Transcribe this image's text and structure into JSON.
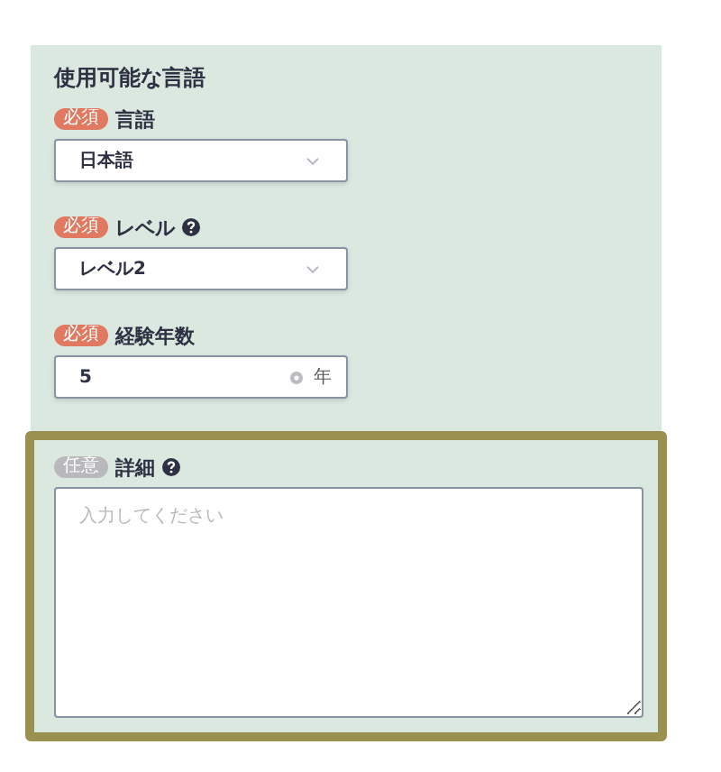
{
  "section": {
    "title": "使用可能な言語"
  },
  "fields": [
    {
      "kind": "select",
      "badge": "必須",
      "required": true,
      "label": "言語",
      "help": false,
      "value": "日本語",
      "highlighted": false
    },
    {
      "kind": "select",
      "badge": "必須",
      "required": true,
      "label": "レベル",
      "help": true,
      "value": "レベル2",
      "highlighted": false
    },
    {
      "kind": "number",
      "badge": "必須",
      "required": true,
      "label": "経験年数",
      "help": false,
      "value": "5",
      "unit": "年",
      "highlighted": false
    },
    {
      "kind": "textarea",
      "badge": "任意",
      "required": false,
      "label": "詳細",
      "help": true,
      "placeholder": "入力してください",
      "highlighted": true
    }
  ]
}
